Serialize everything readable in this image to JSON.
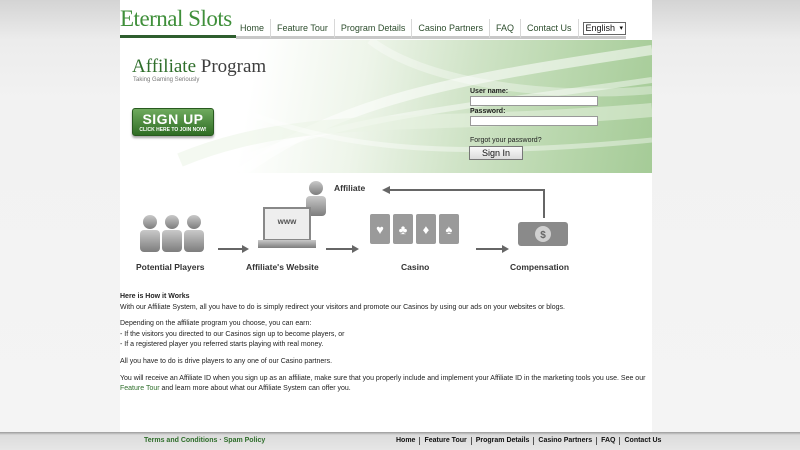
{
  "header": {
    "logo_text": "Eternal Slots",
    "nav": [
      "Home",
      "Feature Tour",
      "Program Details",
      "Casino Partners",
      "FAQ",
      "Contact Us"
    ],
    "language": "English"
  },
  "banner": {
    "title_highlight": "Affiliate",
    "title_rest": " Program",
    "subtitle": "Taking Gaming Seriously",
    "signup_main": "SIGN UP",
    "signup_sub": "CLICK HERE TO JOIN NOW!",
    "username_label": "User name:",
    "password_label": "Password:",
    "forgot_password": "Forgot your password?",
    "signin_button": "Sign In"
  },
  "diagram": {
    "affiliate": "Affiliate",
    "potential_players": "Potential Players",
    "affiliates_website": "Affiliate's Website",
    "website_screen_text": "www",
    "casino": "Casino",
    "compensation": "Compensation"
  },
  "content": {
    "heading": "Here is How it Works",
    "intro": "With our Affiliate System, all you have to do is simply redirect your visitors and promote our Casinos by using our ads on your websites or blogs.",
    "earn_intro": "Depending on the affiliate program you choose, you can earn:",
    "earn_item_1": "- If the visitors you directed to our Casinos sign up to become players, or",
    "earn_item_2": "- If a registered player you referred starts playing with real money.",
    "drive": "All you have to do is drive players to any one of our Casino partners.",
    "id_text_1": "You will receive an Affiliate ID when you sign up as an affiliate, make sure that you properly include and implement your Affiliate ID in the marketing tools you use. See our",
    "feature_tour_link": "Feature Tour",
    "id_text_2": " and learn more about what our Affiliate System can offer you."
  },
  "footer": {
    "left_links": [
      "Terms and Conditions",
      "Spam Policy"
    ],
    "separator": "·",
    "right_links": [
      "Home",
      "Feature Tour",
      "Program Details",
      "Casino Partners",
      "FAQ",
      "Contact Us"
    ]
  },
  "colors": {
    "brand_green": "#2f6e2b",
    "logo_green": "#3f8f3a",
    "button_green": "#4a8a3c"
  }
}
